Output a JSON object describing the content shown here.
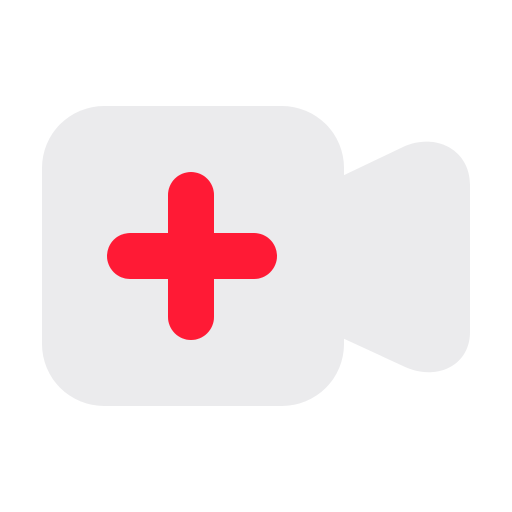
{
  "icon": {
    "name": "add-video-icon",
    "colors": {
      "camera_body": "#EBEBED",
      "plus_sign": "#FF1A35",
      "background": "#FFFFFF"
    }
  }
}
